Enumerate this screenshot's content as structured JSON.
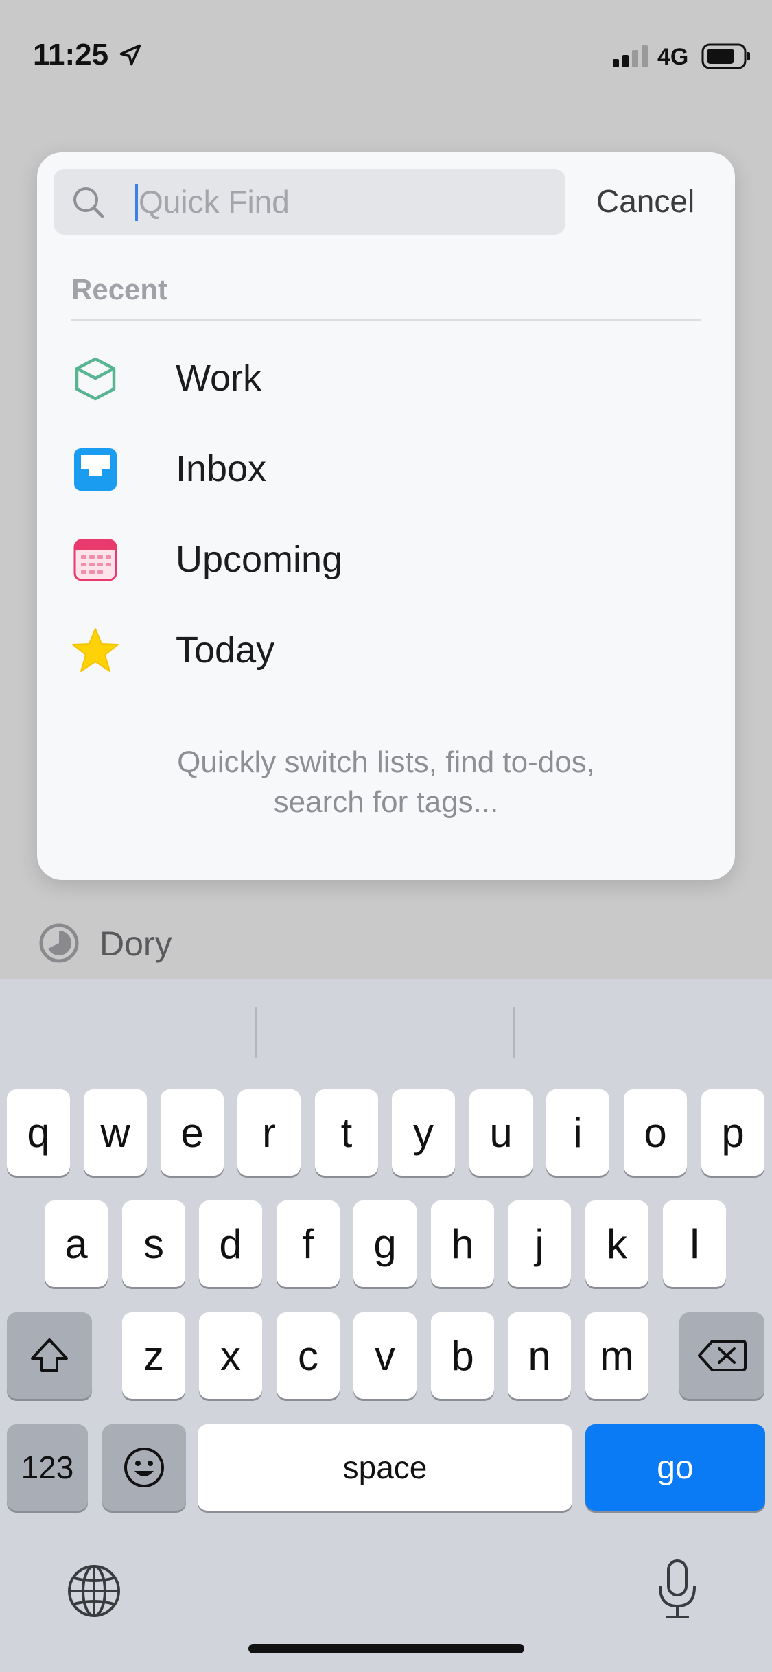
{
  "status_bar": {
    "time": "11:25",
    "network": "4G"
  },
  "panel": {
    "search": {
      "placeholder": "Quick Find",
      "value": ""
    },
    "cancel_label": "Cancel",
    "section_label": "Recent",
    "recent_items": [
      {
        "label": "Work",
        "icon": "work-area-icon",
        "color": "#58b592"
      },
      {
        "label": "Inbox",
        "icon": "inbox-icon",
        "color": "#1a9df0"
      },
      {
        "label": "Upcoming",
        "icon": "calendar-icon",
        "color": "#e83a6d"
      },
      {
        "label": "Today",
        "icon": "star-icon",
        "color": "#ffd208"
      }
    ],
    "hint_line1": "Quickly switch lists, find to-dos,",
    "hint_line2": "search for tags..."
  },
  "background_row": {
    "label": "Dory",
    "icon": "progress-circle-icon"
  },
  "keyboard": {
    "row1": [
      "q",
      "w",
      "e",
      "r",
      "t",
      "y",
      "u",
      "i",
      "o",
      "p"
    ],
    "row2": [
      "a",
      "s",
      "d",
      "f",
      "g",
      "h",
      "j",
      "k",
      "l"
    ],
    "row3": [
      "z",
      "x",
      "c",
      "v",
      "b",
      "n",
      "m"
    ],
    "numbers_label": "123",
    "space_label": "space",
    "go_label": "go",
    "accent_color": "#0b7bf5"
  }
}
